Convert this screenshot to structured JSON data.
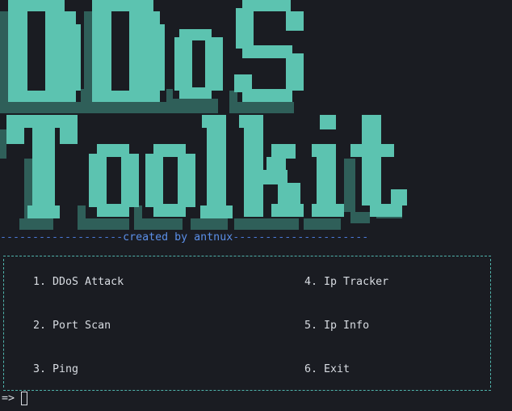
{
  "banner": {
    "line1": "DDoS",
    "line2": "Toolkit",
    "fill_color": "#5cc3b0",
    "shadow_color": "#2f5f59"
  },
  "credit": {
    "left_dashes": "-------------------",
    "text": "created by antnux",
    "right_dashes": "---------------------"
  },
  "menu": {
    "items": [
      {
        "number": "1.",
        "label": "DDoS Attack"
      },
      {
        "number": "2.",
        "label": "Port Scan"
      },
      {
        "number": "3.",
        "label": "Ping"
      },
      {
        "number": "4.",
        "label": "Ip Tracker"
      },
      {
        "number": "5.",
        "label": "Ip Info"
      },
      {
        "number": "6.",
        "label": "Exit"
      }
    ],
    "border_color": "#4fb3ab"
  },
  "prompt": {
    "symbol": "=>"
  }
}
